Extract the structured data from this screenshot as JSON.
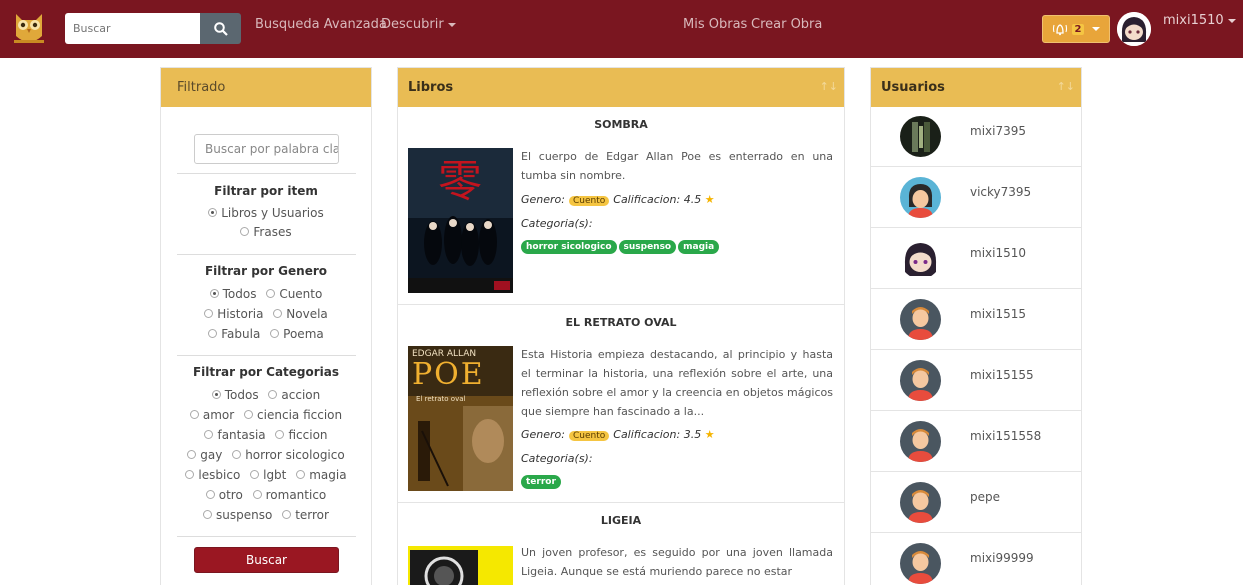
{
  "nav": {
    "search_placeholder": "Buscar",
    "advanced_search": "Busqueda Avanzada",
    "discover": "Descubrir",
    "my_works": "Mis Obras",
    "create_work": "Crear Obra",
    "notif_count": "2",
    "username": "mixi1510"
  },
  "filter": {
    "heading": "Filtrado",
    "keyword_placeholder": "Buscar por palabra clave",
    "by_item_title": "Filtrar por item",
    "item_options": [
      "Libros y Usuarios",
      "Frases"
    ],
    "by_genre_title": "Filtrar por Genero",
    "genre_options": [
      "Todos",
      "Cuento",
      "Historia",
      "Novela",
      "Fabula",
      "Poema"
    ],
    "by_category_title": "Filtrar por Categorias",
    "category_options": [
      "Todos",
      "accion",
      "amor",
      "ciencia ficcion",
      "fantasia",
      "ficcion",
      "gay",
      "horror sicologico",
      "lesbico",
      "lgbt",
      "magia",
      "otro",
      "romantico",
      "suspenso",
      "terror"
    ],
    "search_button": "Buscar"
  },
  "books": {
    "heading": "Libros",
    "genre_label": "Genero:",
    "rating_label": "Calificacion:",
    "categories_label": "Categoria(s):",
    "items": [
      {
        "title": "SOMBRA",
        "description": "El cuerpo de Edgar Allan Poe es enterrado en una tumba sin nombre.",
        "genre": "Cuento",
        "rating": "4.5",
        "tags": [
          "horror sicologico",
          "suspenso",
          "magia"
        ]
      },
      {
        "title": "EL RETRATO OVAL",
        "description": "Esta Historia empieza destacando, al principio y hasta el terminar la historia, una reflexión sobre el arte, una reflexión sobre el amor y la creencia en objetos mágicos que siempre han fascinado a la...",
        "genre": "Cuento",
        "rating": "3.5",
        "tags": [
          "terror"
        ],
        "cover_text": [
          "EDGAR ALLAN",
          "POE",
          "El retrato oval"
        ]
      },
      {
        "title": "LIGEIA",
        "description": "Un joven profesor, es seguido por una joven llamada Ligeia. Aunque se está muriendo parece no estar"
      }
    ]
  },
  "users": {
    "heading": "Usuarios",
    "items": [
      "mixi7395",
      "vicky7395",
      "mixi1510",
      "mixi1515",
      "mixi15155",
      "mixi151558",
      "pepe",
      "mixi99999"
    ]
  },
  "colors": {
    "navbar": "#7a1620",
    "panel_header": "#e9bc54",
    "tag_green": "#2aa84a",
    "genre_yellow": "#f5c542",
    "notif_orange": "#e8a53a"
  }
}
